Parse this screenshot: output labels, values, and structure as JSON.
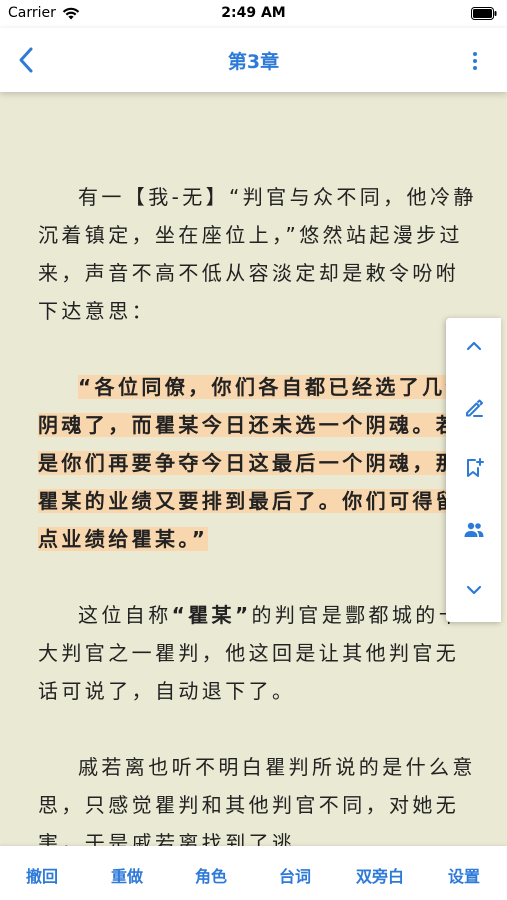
{
  "status_bar": {
    "carrier": "Carrier",
    "time": "2:49 AM"
  },
  "nav": {
    "title": "第3章",
    "back_icon": "chevron-left-icon",
    "more_icon": "more-vertical-icon"
  },
  "reader": {
    "p1": "有一【我-无】“判官与众不同，他冷静沉着镇定，坐在座位上，”悠然站起漫步过来，声音不高不低从容淡定却是敕令吩咐下达意思：",
    "p2": "“各位同僚，你们各自都已经选了几个阴魂了，而瞿某今日还未选一个阴魂。若是你们再要争夺今日这最后一个阴魂，那瞿某的业绩又要排到最后了。你们可得留点业绩给瞿某。”",
    "p3_before": "这位自称",
    "p3_bold": "“瞿某”",
    "p3_after": "的判官是酆都城的十大判官之一瞿判，他这回是让其他判官无话可说了，自动退下了。",
    "p4": "戚若离也听不明白瞿判所说的是什么意思，只感觉瞿判和其他判官不同，对她无害，于是戚若离找到了逃"
  },
  "side_panel": {
    "icons": [
      "chevron-up-icon",
      "pen-icon",
      "bookmark-add-icon",
      "people-icon",
      "chevron-down-icon"
    ]
  },
  "toolbar": {
    "undo": "撤回",
    "redo": "重做",
    "role": "角色",
    "line": "台词",
    "narration": "双旁白",
    "settings": "设置"
  },
  "colors": {
    "accent": "#2e7ad9",
    "page_bg": "#eae9d3",
    "highlight": "#f8d7ae"
  }
}
